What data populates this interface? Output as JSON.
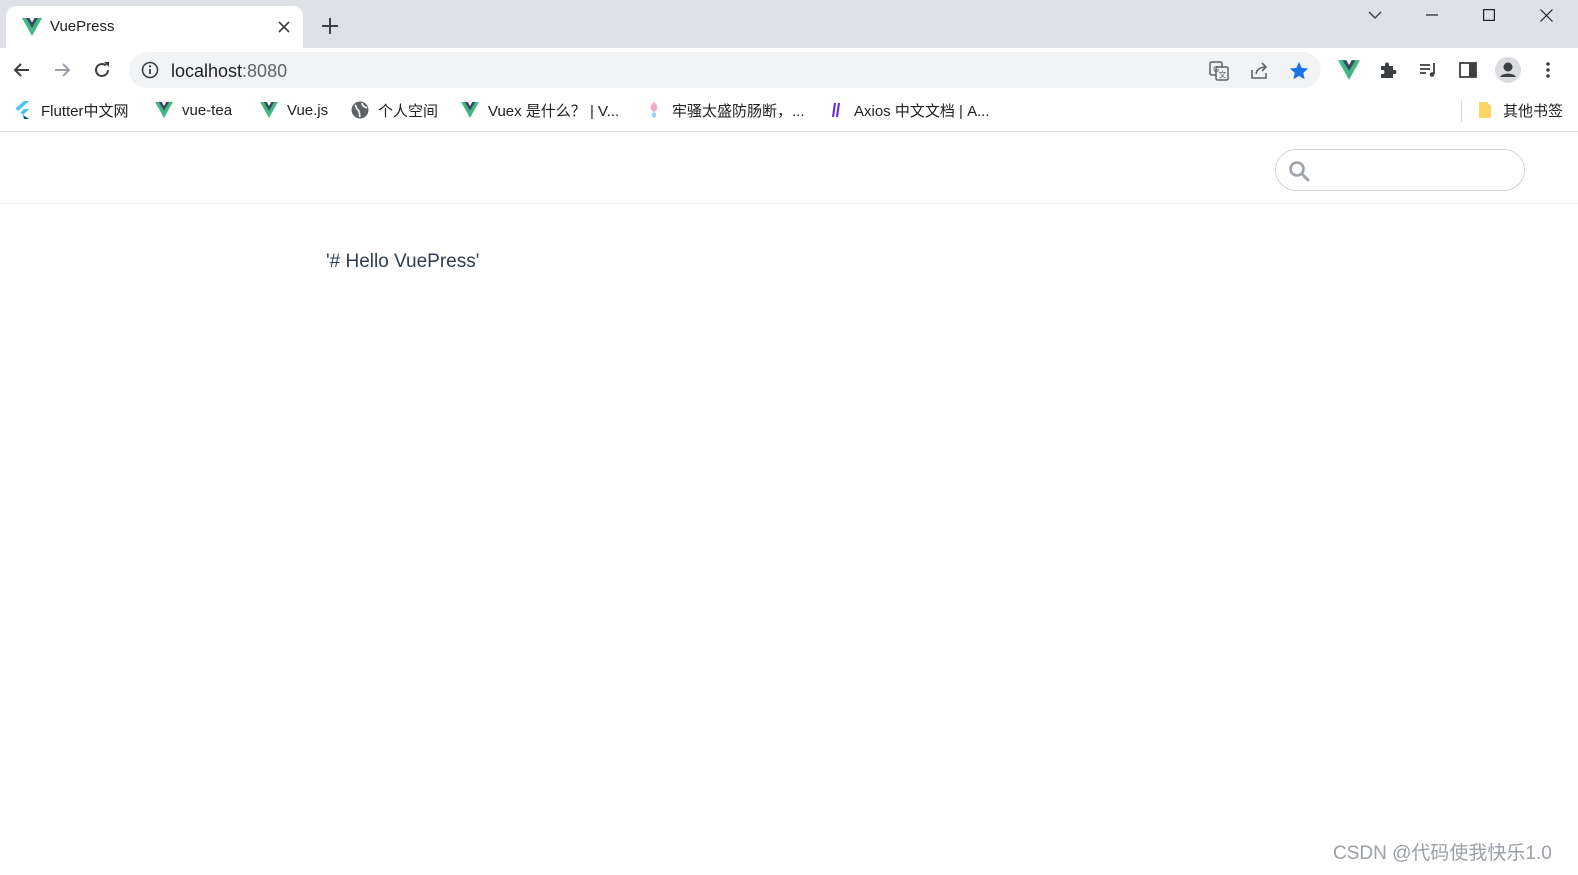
{
  "tab": {
    "title": "VuePress"
  },
  "omnibox": {
    "host": "localhost",
    "port": ":8080"
  },
  "bookmarks": [
    {
      "label": "Flutter中文网",
      "icon": "flutter-icon"
    },
    {
      "label": "vue-tea",
      "icon": "vue-icon"
    },
    {
      "label": "Vue.js",
      "icon": "vue-icon"
    },
    {
      "label": "个人空间",
      "icon": "globe-icon"
    },
    {
      "label": "Vuex 是什么？ | V...",
      "icon": "vue-icon"
    },
    {
      "label": "牢骚太盛防肠断，...",
      "icon": "feather-icon"
    },
    {
      "label": "Axios 中文文档 | A...",
      "icon": "axios-icon"
    }
  ],
  "other_bookmarks": {
    "label": "其他书签",
    "icon": "folder-icon"
  },
  "page": {
    "search_placeholder": "",
    "content": "'# Hello VuePress'"
  },
  "watermark": "CSDN @代码使我快乐1.0",
  "colors": {
    "vue_green": "#41b883",
    "vue_dark": "#35495e",
    "star_blue": "#1a73e8",
    "text": "#2c3e50"
  }
}
